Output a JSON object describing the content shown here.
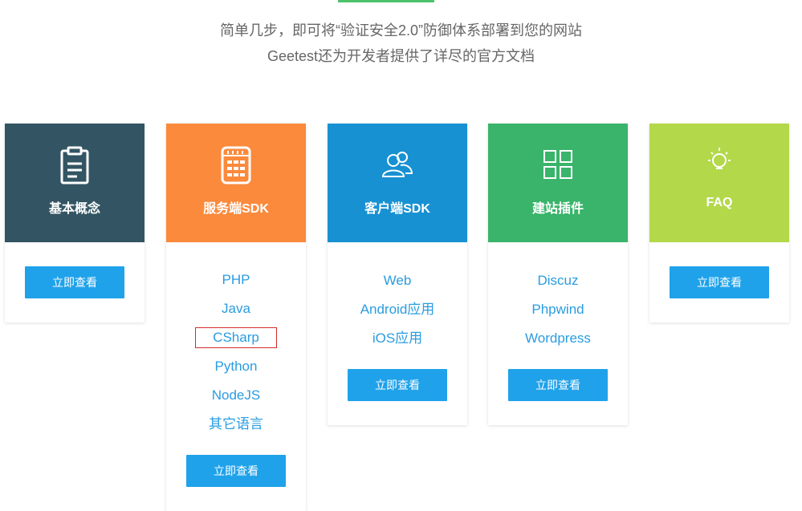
{
  "intro": {
    "line1": "简单几步，即可将“验证安全2.0”防御体系部署到您的网站",
    "line2": "Geetest还为开发者提供了详尽的官方文档"
  },
  "cards": [
    {
      "title": "基本概念",
      "icon": "clipboard-icon",
      "color": "#335563",
      "links": [],
      "button": "立即查看"
    },
    {
      "title": "服务端SDK",
      "icon": "server-icon",
      "color": "#fb8a3c",
      "links": [
        "PHP",
        "Java",
        "CSharp",
        "Python",
        "NodeJS",
        "其它语言"
      ],
      "highlighted": "CSharp",
      "button": "立即查看"
    },
    {
      "title": "客户端SDK",
      "icon": "users-icon",
      "color": "#1891d2",
      "links": [
        "Web",
        "Android应用",
        "iOS应用"
      ],
      "button": "立即查看"
    },
    {
      "title": "建站插件",
      "icon": "grid-icon",
      "color": "#39b46a",
      "links": [
        "Discuz",
        "Phpwind",
        "Wordpress"
      ],
      "button": "立即查看"
    },
    {
      "title": "FAQ",
      "icon": "lightbulb-icon",
      "color": "#b3d84a",
      "links": [],
      "button": "立即查看"
    }
  ],
  "colors": {
    "button": "#1fa2ea",
    "link": "#2a9ce0",
    "highlight_border": "#d32b2b"
  }
}
